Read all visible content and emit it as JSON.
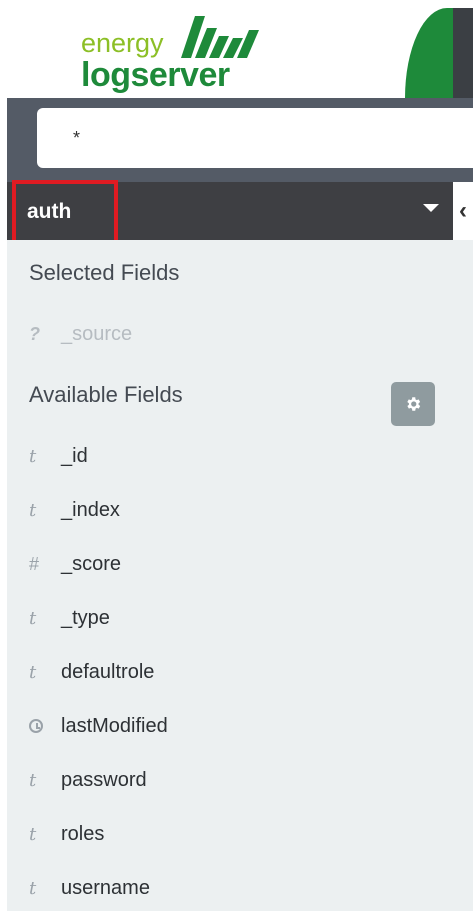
{
  "logo": {
    "line1": "energy",
    "line2": "logserver"
  },
  "search": {
    "value": "*"
  },
  "index_pattern": {
    "selected": "auth"
  },
  "collapse_glyph": "‹",
  "selected_fields": {
    "title": "Selected Fields",
    "items": [
      {
        "type": "?",
        "name": "_source"
      }
    ]
  },
  "available_fields": {
    "title": "Available Fields",
    "settings_icon": "gear-icon",
    "items": [
      {
        "type": "t",
        "name": "_id"
      },
      {
        "type": "t",
        "name": "_index"
      },
      {
        "type": "#",
        "name": "_score"
      },
      {
        "type": "t",
        "name": "_type"
      },
      {
        "type": "t",
        "name": "defaultrole"
      },
      {
        "type": "clock-icon",
        "name": "lastModified"
      },
      {
        "type": "t",
        "name": "password"
      },
      {
        "type": "t",
        "name": "roles"
      },
      {
        "type": "t",
        "name": "username"
      }
    ]
  },
  "colors": {
    "brand_green": "#1e8a3a",
    "brand_lime": "#8cbf26",
    "search_bg": "#545b66",
    "selector_bg": "#3e3f43",
    "sidebar_bg": "#ecf0f1",
    "highlight": "#e01b22",
    "gear_button": "#8f9b9f"
  }
}
